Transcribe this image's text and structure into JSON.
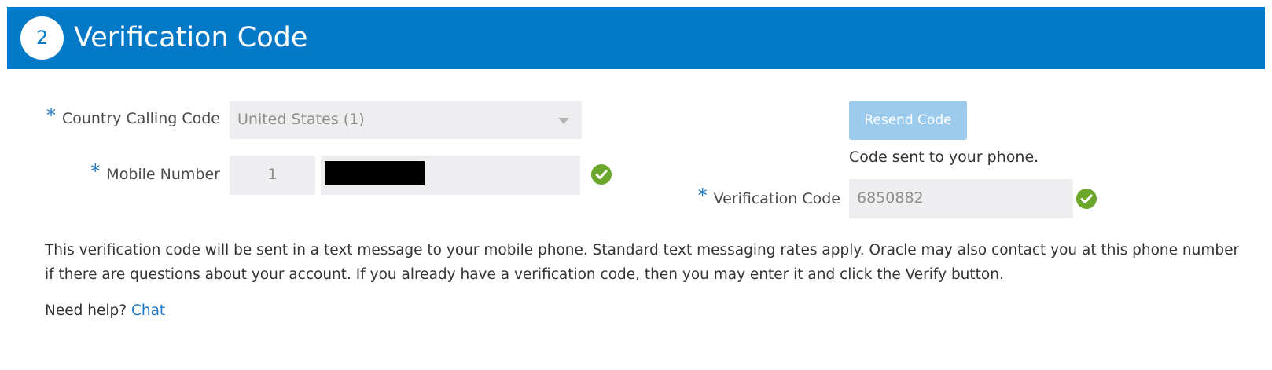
{
  "header": {
    "step_number": "2",
    "title": "Verification Code",
    "background_color": "#0479c8"
  },
  "form": {
    "required_marker": "*",
    "country_calling_code": {
      "label": "Country Calling Code",
      "selected_value": "United States (1)"
    },
    "mobile_number": {
      "label": "Mobile Number",
      "country_prefix": "1",
      "number_value": "",
      "status_icon": "check-circle-icon"
    },
    "verification_code": {
      "label": "Verification Code",
      "value": "6850882",
      "status_icon": "check-circle-icon"
    },
    "resend_button_label": "Resend Code",
    "code_sent_message": "Code sent to your phone."
  },
  "info": {
    "description": "This verification code will be sent in a text message to your mobile phone. Standard text messaging rates apply. Oracle may also contact you at this phone number if there are questions about your account. If you already have a verification code, then you may enter it and click the Verify button.",
    "help_prefix": "Need help?",
    "chat_link": "Chat"
  },
  "colors": {
    "accent": "#1f78c1",
    "success": "#6aa72a",
    "input_background": "#eeeef0",
    "button_disabled": "#9dcbed"
  }
}
